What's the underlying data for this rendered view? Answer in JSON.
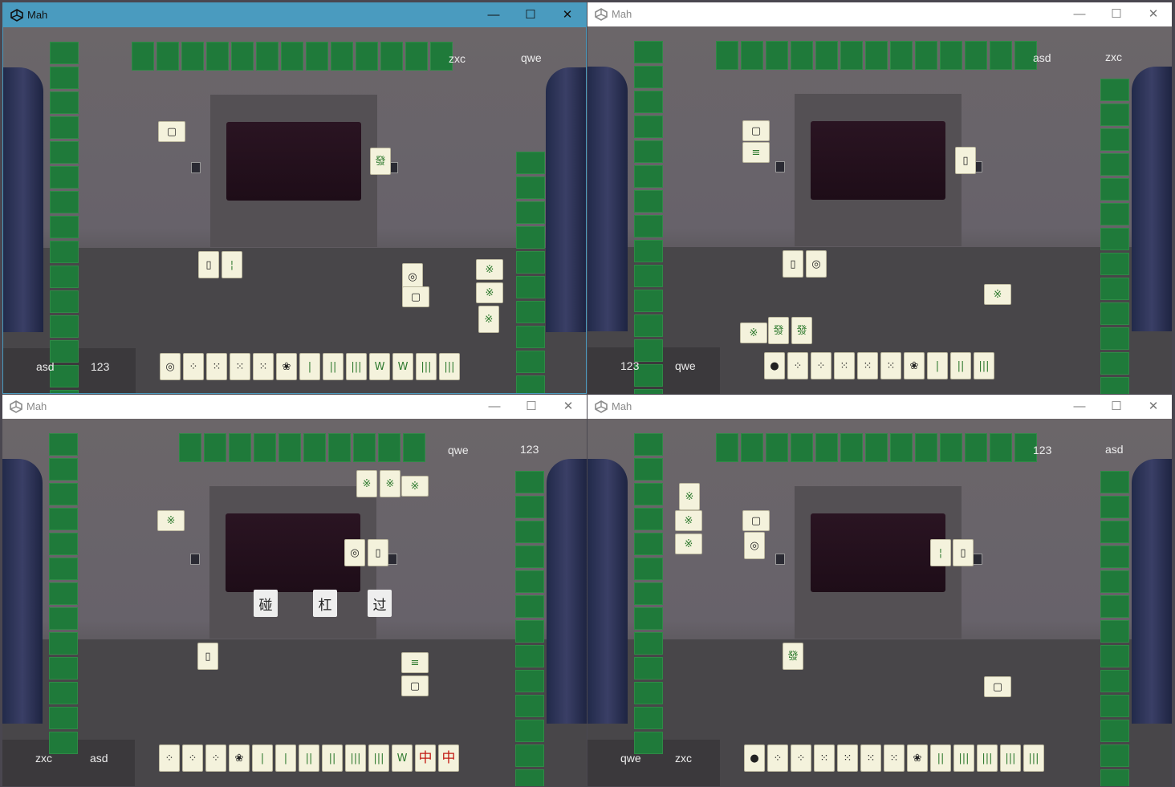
{
  "windows": [
    {
      "id": "tl",
      "title": "Mah",
      "active": true,
      "controls": {
        "minimize": "—",
        "maximize": "☐",
        "close": "✕"
      },
      "players": {
        "top_left": "zxc",
        "top_right": "qwe",
        "bottom_left": "asd",
        "bottom_right": "123"
      },
      "hand": [
        {
          "g": "◎",
          "c": "blk"
        },
        {
          "g": "⁘",
          "c": "blk"
        },
        {
          "g": "⁙",
          "c": "blk"
        },
        {
          "g": "⁙",
          "c": "blk"
        },
        {
          "g": "⁙",
          "c": "blk"
        },
        {
          "g": "❀",
          "c": "blk"
        },
        {
          "g": "|",
          "c": "grn"
        },
        {
          "g": "||",
          "c": "grn"
        },
        {
          "g": "|||",
          "c": "grn"
        },
        {
          "g": "W",
          "c": "grn"
        },
        {
          "g": "W",
          "c": "grn"
        },
        {
          "g": "|||",
          "c": "grn"
        },
        {
          "g": "|||",
          "c": "grn"
        }
      ],
      "discards": [
        {
          "g": "▢",
          "c": "blk"
        },
        {
          "g": "▯",
          "c": "blk"
        },
        {
          "g": "¦",
          "c": "grn"
        },
        {
          "g": "◎",
          "c": "blk"
        },
        {
          "g": "▢",
          "c": "blk"
        },
        {
          "g": "※",
          "c": "grn"
        },
        {
          "g": "※",
          "c": "grn"
        },
        {
          "g": "※",
          "c": "grn"
        },
        {
          "g": "發",
          "c": "grn"
        }
      ],
      "buttons": []
    },
    {
      "id": "tr",
      "title": "Mah",
      "active": false,
      "controls": {
        "minimize": "—",
        "maximize": "☐",
        "close": "✕"
      },
      "players": {
        "top_left": "asd",
        "top_right": "zxc",
        "bottom_left": "123",
        "bottom_right": "qwe"
      },
      "hand": [
        {
          "g": "●",
          "c": "blk"
        },
        {
          "g": "⁘",
          "c": "blk"
        },
        {
          "g": "⁘",
          "c": "blk"
        },
        {
          "g": "⁙",
          "c": "blk"
        },
        {
          "g": "⁙",
          "c": "blk"
        },
        {
          "g": "⁙",
          "c": "blk"
        },
        {
          "g": "❀",
          "c": "blk"
        },
        {
          "g": "|",
          "c": "grn"
        },
        {
          "g": "||",
          "c": "grn"
        },
        {
          "g": "|||",
          "c": "grn"
        }
      ],
      "discards": [
        {
          "g": "▢",
          "c": "blk"
        },
        {
          "g": "≡",
          "c": "grn"
        },
        {
          "g": "▯",
          "c": "blk"
        },
        {
          "g": "▯",
          "c": "blk"
        },
        {
          "g": "◎",
          "c": "blk"
        },
        {
          "g": "※",
          "c": "grn"
        },
        {
          "g": "※",
          "c": "grn"
        },
        {
          "g": "發",
          "c": "grn"
        },
        {
          "g": "發",
          "c": "grn"
        }
      ],
      "buttons": []
    },
    {
      "id": "bl",
      "title": "Mah",
      "active": false,
      "controls": {
        "minimize": "—",
        "maximize": "☐",
        "close": "✕"
      },
      "players": {
        "top_left": "qwe",
        "top_right": "123",
        "bottom_left": "zxc",
        "bottom_right": "asd"
      },
      "hand": [
        {
          "g": "⁘",
          "c": "blk"
        },
        {
          "g": "⁘",
          "c": "blk"
        },
        {
          "g": "⁘",
          "c": "blk"
        },
        {
          "g": "❀",
          "c": "blk"
        },
        {
          "g": "|",
          "c": "grn"
        },
        {
          "g": "|",
          "c": "grn"
        },
        {
          "g": "||",
          "c": "grn"
        },
        {
          "g": "||",
          "c": "grn"
        },
        {
          "g": "|||",
          "c": "grn"
        },
        {
          "g": "|||",
          "c": "grn"
        },
        {
          "g": "W",
          "c": "grn"
        },
        {
          "g": "中",
          "c": "red"
        },
        {
          "g": "中",
          "c": "red"
        }
      ],
      "discards": [
        {
          "g": "※",
          "c": "grn"
        },
        {
          "g": "※",
          "c": "grn"
        },
        {
          "g": "※",
          "c": "grn"
        },
        {
          "g": "※",
          "c": "grn"
        },
        {
          "g": "◎",
          "c": "blk"
        },
        {
          "g": "▯",
          "c": "blk"
        },
        {
          "g": "▯",
          "c": "blk"
        },
        {
          "g": "≡",
          "c": "grn"
        },
        {
          "g": "▢",
          "c": "blk"
        }
      ],
      "buttons": [
        {
          "label": "碰",
          "name": "pong-button"
        },
        {
          "label": "杠",
          "name": "kong-button"
        },
        {
          "label": "过",
          "name": "pass-button"
        }
      ]
    },
    {
      "id": "br",
      "title": "Mah",
      "active": false,
      "controls": {
        "minimize": "—",
        "maximize": "☐",
        "close": "✕"
      },
      "players": {
        "top_left": "123",
        "top_right": "asd",
        "bottom_left": "qwe",
        "bottom_right": "zxc"
      },
      "hand": [
        {
          "g": "●",
          "c": "blk"
        },
        {
          "g": "⁘",
          "c": "blk"
        },
        {
          "g": "⁘",
          "c": "blk"
        },
        {
          "g": "⁙",
          "c": "blk"
        },
        {
          "g": "⁙",
          "c": "blk"
        },
        {
          "g": "⁙",
          "c": "blk"
        },
        {
          "g": "⁙",
          "c": "blk"
        },
        {
          "g": "❀",
          "c": "blk"
        },
        {
          "g": "||",
          "c": "grn"
        },
        {
          "g": "|||",
          "c": "grn"
        },
        {
          "g": "|||",
          "c": "grn"
        },
        {
          "g": "|||",
          "c": "grn"
        },
        {
          "g": "|||",
          "c": "grn"
        }
      ],
      "discards": [
        {
          "g": "※",
          "c": "grn"
        },
        {
          "g": "※",
          "c": "grn"
        },
        {
          "g": "※",
          "c": "grn"
        },
        {
          "g": "▢",
          "c": "blk"
        },
        {
          "g": "◎",
          "c": "blk"
        },
        {
          "g": "¦",
          "c": "grn"
        },
        {
          "g": "▯",
          "c": "blk"
        },
        {
          "g": "發",
          "c": "grn"
        },
        {
          "g": "▢",
          "c": "blk"
        }
      ],
      "buttons": []
    }
  ]
}
